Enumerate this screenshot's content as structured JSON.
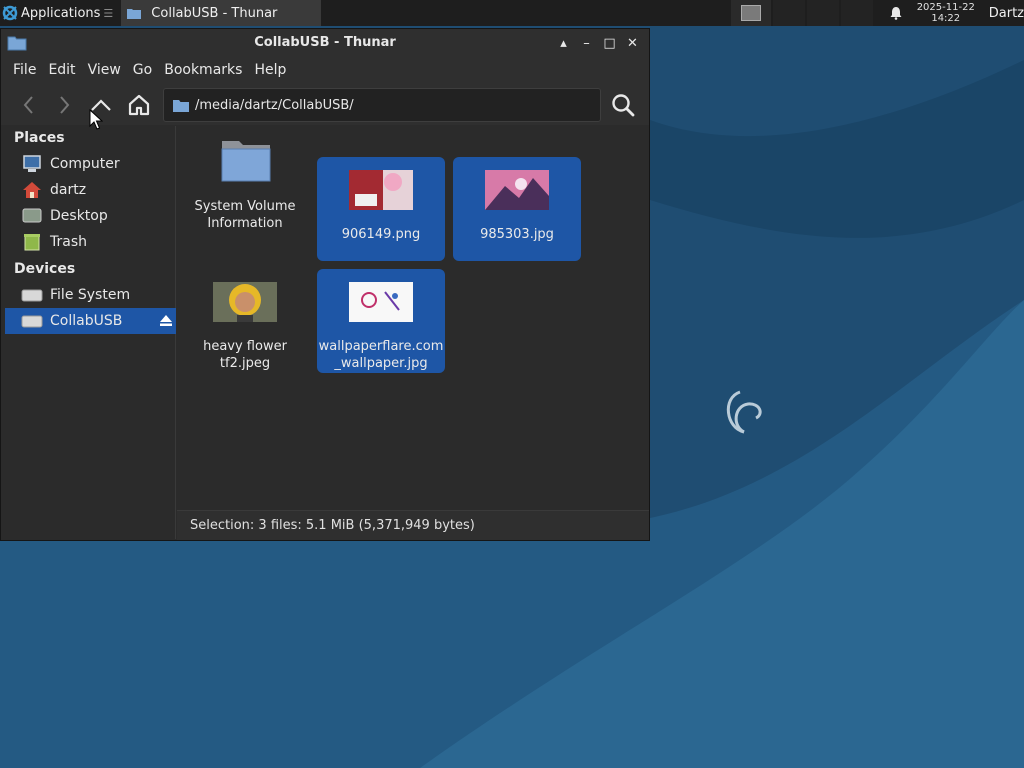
{
  "panel": {
    "applications_label": "Applications",
    "separator": "☰",
    "task_title": "CollabUSB - Thunar",
    "clock_date": "2025-11-22",
    "clock_time": "14:22",
    "user": "Dartz"
  },
  "window": {
    "title": "CollabUSB - Thunar",
    "controls": [
      "▴",
      "–",
      "□",
      "✕"
    ]
  },
  "menu": [
    "File",
    "Edit",
    "View",
    "Go",
    "Bookmarks",
    "Help"
  ],
  "location": {
    "path": "/media/dartz/CollabUSB/"
  },
  "sidebar": {
    "places_heading": "Places",
    "places": [
      {
        "label": "Computer",
        "icon": "computer-icon"
      },
      {
        "label": "dartz",
        "icon": "home-icon"
      },
      {
        "label": "Desktop",
        "icon": "desktop-icon"
      },
      {
        "label": "Trash",
        "icon": "trash-icon"
      }
    ],
    "devices_heading": "Devices",
    "devices": [
      {
        "label": "File System",
        "icon": "drive-icon"
      },
      {
        "label": "CollabUSB",
        "icon": "drive-icon",
        "selected": true
      }
    ]
  },
  "files": [
    {
      "name_line1": "System Volume",
      "name_line2": "Information",
      "type": "folder",
      "selected": false
    },
    {
      "name_line1": "906149.png",
      "name_line2": "",
      "type": "image",
      "selected": true
    },
    {
      "name_line1": "985303.jpg",
      "name_line2": "",
      "type": "image",
      "selected": true
    },
    {
      "name_line1": "heavy flower",
      "name_line2": "tf2.jpeg",
      "type": "image",
      "selected": false
    },
    {
      "name_line1": "wallpaperflare.com",
      "name_line2": "_wallpaper.jpg",
      "type": "image",
      "selected": true
    }
  ],
  "status": {
    "text": "Selection: 3 files: 5.1 MiB (5,371,949 bytes)"
  },
  "colors": {
    "selection": "#1e56a6",
    "window_bg": "#2b2b2b",
    "desktop": "#1d4a6e"
  }
}
